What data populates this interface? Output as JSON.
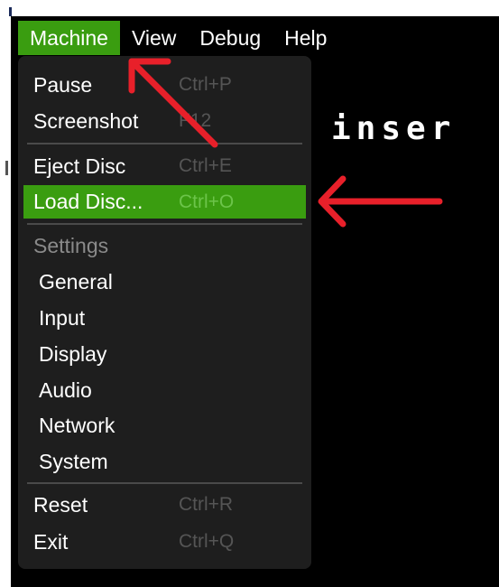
{
  "menubar": {
    "items": [
      {
        "label": "Machine"
      },
      {
        "label": "View"
      },
      {
        "label": "Debug"
      },
      {
        "label": "Help"
      }
    ]
  },
  "screen": {
    "text": "inser"
  },
  "machine_menu": {
    "items": [
      {
        "label": "Pause",
        "shortcut": "Ctrl+P"
      },
      {
        "label": "Screenshot",
        "shortcut": "F12"
      },
      {
        "label": "Eject Disc",
        "shortcut": "Ctrl+E"
      },
      {
        "label": "Load Disc...",
        "shortcut": "Ctrl+O",
        "highlighted": true
      },
      {
        "label": "Settings",
        "header": true
      },
      {
        "label": "General"
      },
      {
        "label": "Input"
      },
      {
        "label": "Display"
      },
      {
        "label": "Audio"
      },
      {
        "label": "Network"
      },
      {
        "label": "System"
      },
      {
        "label": "Reset",
        "shortcut": "Ctrl+R"
      },
      {
        "label": "Exit",
        "shortcut": "Ctrl+Q"
      }
    ]
  },
  "colors": {
    "accent": "#3a9d10",
    "menu_bg": "#1e1e1e",
    "annotation": "#e8202a"
  }
}
